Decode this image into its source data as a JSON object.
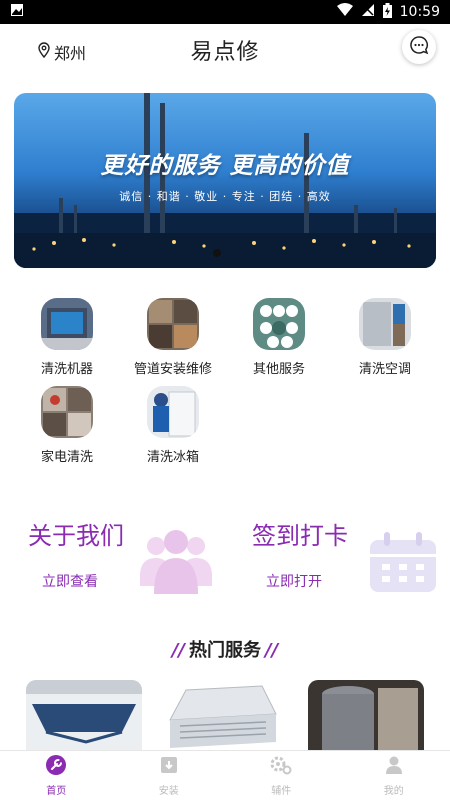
{
  "status_bar": {
    "time": "10:59"
  },
  "header": {
    "location": "郑州",
    "title": "易点修"
  },
  "banner": {
    "headline": "更好的服务  更高的价值",
    "subline": "诚信 · 和谐 · 敬业 · 专注 · 团结 · 高效"
  },
  "services": [
    {
      "label": "清洗机器"
    },
    {
      "label": "管道安装维修"
    },
    {
      "label": "其他服务"
    },
    {
      "label": "清洗空调"
    },
    {
      "label": "家电清洗"
    },
    {
      "label": "清洗冰箱"
    }
  ],
  "promos": [
    {
      "title": "关于我们",
      "link": "立即查看"
    },
    {
      "title": "签到打卡",
      "link": "立即打开"
    }
  ],
  "section": {
    "title": "热门服务"
  },
  "tabs": [
    {
      "label": "首页",
      "icon": "wrench-icon",
      "active": true
    },
    {
      "label": "安装",
      "icon": "install-box-icon",
      "active": false
    },
    {
      "label": "辅件",
      "icon": "gear-icon",
      "active": false
    },
    {
      "label": "我的",
      "icon": "user-icon",
      "active": false
    }
  ],
  "colors": {
    "accent": "#8a2bb2",
    "promo_icon": "#f0d6f0",
    "calendar_icon": "#e6e2f5"
  }
}
